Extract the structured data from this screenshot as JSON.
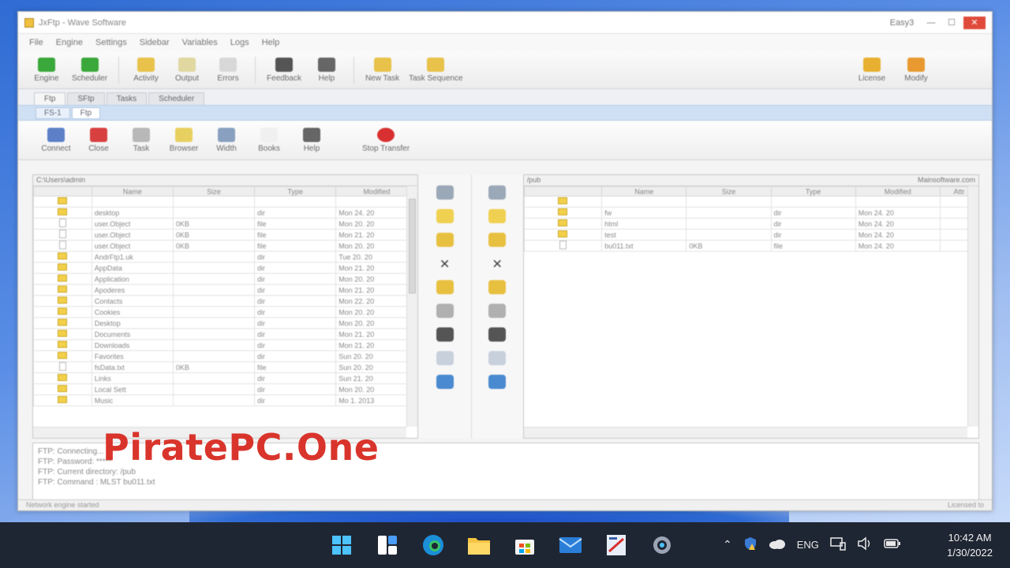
{
  "window": {
    "title": "JxFtp - Wave Software",
    "controls": {
      "minimize": "—",
      "maximize": "☐",
      "close": "✕",
      "extra": "Easy3"
    }
  },
  "menu": [
    "File",
    "Engine",
    "Settings",
    "Sidebar",
    "Variables",
    "Logs",
    "Help"
  ],
  "toolbar": {
    "buttons": [
      {
        "label": "Engine",
        "icon": "engine-icon",
        "color": "#3aa83a"
      },
      {
        "label": "Scheduler",
        "icon": "scheduler-icon",
        "color": "#3aa83a"
      },
      {
        "label": "Activity",
        "icon": "activity-icon",
        "color": "#e8c24a"
      },
      {
        "label": "Output",
        "icon": "output-icon",
        "color": "#e0d8a0"
      },
      {
        "label": "Errors",
        "icon": "errors-icon",
        "color": "#d8d8d8"
      },
      {
        "label": "Feedback",
        "icon": "feedback-icon",
        "color": "#555555"
      },
      {
        "label": "Help",
        "icon": "help-icon",
        "color": "#666666"
      },
      {
        "label": "New Task",
        "icon": "new-task-icon",
        "color": "#e8c24a"
      },
      {
        "label": "Task Sequence",
        "icon": "task-sequence-icon",
        "color": "#e8c24a"
      }
    ],
    "right_buttons": [
      {
        "label": "License",
        "icon": "license-icon",
        "color": "#e8b030"
      },
      {
        "label": "Modify",
        "icon": "modify-icon",
        "color": "#e89a30"
      }
    ]
  },
  "tabs": [
    "Ftp",
    "SFtp",
    "Tasks",
    "Scheduler"
  ],
  "subtabs": [
    "FS-1",
    "Ftp"
  ],
  "connection_toolbar": [
    {
      "label": "Connect",
      "icon": "connect-icon",
      "color": "#5c7fc8"
    },
    {
      "label": "Close",
      "icon": "close-connection-icon",
      "color": "#d84040"
    },
    {
      "label": "Task",
      "icon": "task-icon",
      "color": "#b8b8b8"
    },
    {
      "label": "Browser",
      "icon": "browser-icon",
      "color": "#e8d060"
    },
    {
      "label": "Width",
      "icon": "width-icon",
      "color": "#8aa0c0"
    },
    {
      "label": "Books",
      "icon": "books-icon",
      "color": "#f0f0f0"
    },
    {
      "label": "Help",
      "icon": "help-icon",
      "color": "#666666"
    },
    {
      "label": "Stop Transfer",
      "icon": "stop-transfer-icon",
      "color": "#d83030"
    }
  ],
  "local_pane": {
    "path": "C:\\Users\\admin",
    "columns": [
      "",
      "Name",
      "Size",
      "Type",
      "Modified"
    ],
    "rows": [
      {
        "kind": "up",
        "name": "",
        "size": "",
        "type": "",
        "modified": ""
      },
      {
        "kind": "folder",
        "name": "desktop",
        "size": "",
        "type": "dir",
        "modified": "Mon 24. 20"
      },
      {
        "kind": "file",
        "name": "user.Object",
        "size": "0KB",
        "type": "file",
        "modified": "Mon 20. 20"
      },
      {
        "kind": "file",
        "name": "user.Object",
        "size": "0KB",
        "type": "file",
        "modified": "Mon 21. 20"
      },
      {
        "kind": "file",
        "name": "user.Object",
        "size": "0KB",
        "type": "file",
        "modified": "Mon 20. 20"
      },
      {
        "kind": "folder",
        "name": "AndrFtp1.uk",
        "size": "",
        "type": "dir",
        "modified": "Tue 20. 20"
      },
      {
        "kind": "folder",
        "name": "AppData",
        "size": "",
        "type": "dir",
        "modified": "Mon 21. 20"
      },
      {
        "kind": "folder",
        "name": "Application",
        "size": "",
        "type": "dir",
        "modified": "Mon 20. 20"
      },
      {
        "kind": "folder",
        "name": "Apoderes",
        "size": "",
        "type": "dir",
        "modified": "Mon 21. 20"
      },
      {
        "kind": "folder",
        "name": "Contacts",
        "size": "",
        "type": "dir",
        "modified": "Mon 22. 20"
      },
      {
        "kind": "folder",
        "name": "Cookies",
        "size": "",
        "type": "dir",
        "modified": "Mon 20. 20"
      },
      {
        "kind": "folder",
        "name": "Desktop",
        "size": "",
        "type": "dir",
        "modified": "Mon 20. 20"
      },
      {
        "kind": "folder",
        "name": "Documents",
        "size": "",
        "type": "dir",
        "modified": "Mon 21. 20"
      },
      {
        "kind": "folder",
        "name": "Downloads",
        "size": "",
        "type": "dir",
        "modified": "Mon 21. 20"
      },
      {
        "kind": "folder",
        "name": "Favorites",
        "size": "",
        "type": "dir",
        "modified": "Sun 20. 20"
      },
      {
        "kind": "file",
        "name": "fsData.txt",
        "size": "0KB",
        "type": "file",
        "modified": "Sun 20. 20"
      },
      {
        "kind": "folder",
        "name": "Links",
        "size": "",
        "type": "dir",
        "modified": "Sun 21. 20"
      },
      {
        "kind": "folder",
        "name": "Local Sett",
        "size": "",
        "type": "dir",
        "modified": "Mon 20. 20"
      },
      {
        "kind": "folder",
        "name": "Music",
        "size": "",
        "type": "dir",
        "modified": "Mo 1. 2013"
      }
    ]
  },
  "middle_buttons": [
    "refresh-icon",
    "folder-icon",
    "folder-open-icon",
    "delete-icon",
    "rename-icon",
    "view-icon",
    "edit-icon",
    "search-icon",
    "sync-icon"
  ],
  "remote_pane": {
    "path": "/pub",
    "server": "Mainsoftware.com",
    "columns": [
      "",
      "Name",
      "Size",
      "Type",
      "Modified",
      "Attr"
    ],
    "rows": [
      {
        "kind": "up",
        "name": "",
        "size": "",
        "type": "",
        "modified": "",
        "attr": ""
      },
      {
        "kind": "folder",
        "name": "fw",
        "size": "",
        "type": "dir",
        "modified": "Mon 24. 20",
        "attr": ""
      },
      {
        "kind": "folder",
        "name": "html",
        "size": "",
        "type": "dir",
        "modified": "Mon 24. 20",
        "attr": ""
      },
      {
        "kind": "folder",
        "name": "test",
        "size": "",
        "type": "dir",
        "modified": "Mon 24. 20",
        "attr": ""
      },
      {
        "kind": "file",
        "name": "bu011.txt",
        "size": "0KB",
        "type": "file",
        "modified": "Mon 24. 20",
        "attr": ""
      }
    ]
  },
  "log_lines": [
    "FTP: Connecting...",
    "FTP: Password: *****",
    "FTP: Current directory: /pub",
    "FTP: Command : MLST bu011.txt"
  ],
  "status": {
    "left": "Network engine started",
    "right": "Licensed to"
  },
  "watermark": "PiratePC.One",
  "taskbar": {
    "apps": [
      "windows-start-icon",
      "widgets-icon",
      "edge-icon",
      "file-explorer-icon",
      "store-icon",
      "mail-icon",
      "ftp-app-icon",
      "settings-icon"
    ],
    "language": "ENG",
    "time": "10:42 AM",
    "date": "1/30/2022"
  }
}
